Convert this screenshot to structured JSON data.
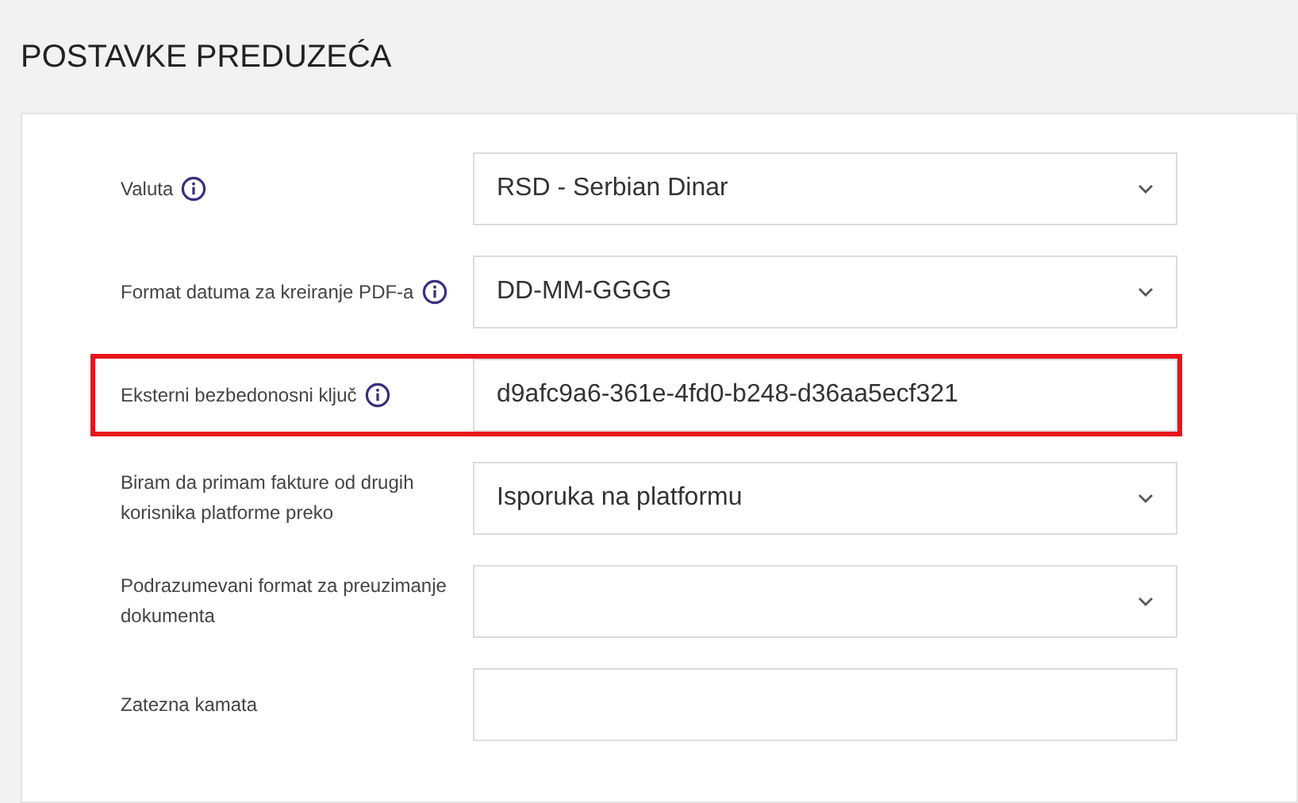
{
  "page_title": "POSTAVKE PREDUZEĆA",
  "fields": [
    {
      "label": "Valuta",
      "info": true,
      "kind": "select",
      "value": "RSD - Serbian Dinar",
      "highlighted": false
    },
    {
      "label": "Format datuma za kreiranje PDF-a",
      "info": true,
      "kind": "select",
      "value": "DD-MM-GGGG",
      "highlighted": false
    },
    {
      "label": "Eksterni bezbedonosni ključ",
      "info": true,
      "kind": "text",
      "value": "d9afc9a6-361e-4fd0-b248-d36aa5ecf321",
      "highlighted": true
    },
    {
      "label": "Biram da primam fakture od drugih korisnika platforme preko",
      "info": false,
      "kind": "select",
      "value": "Isporuka na platformu",
      "highlighted": false
    },
    {
      "label": "Podrazumevani format za preuzimanje dokumenta",
      "info": false,
      "kind": "select",
      "highlighted": false
    },
    {
      "label": "Zatezna kamata",
      "info": false,
      "kind": "text",
      "highlighted": false
    }
  ]
}
